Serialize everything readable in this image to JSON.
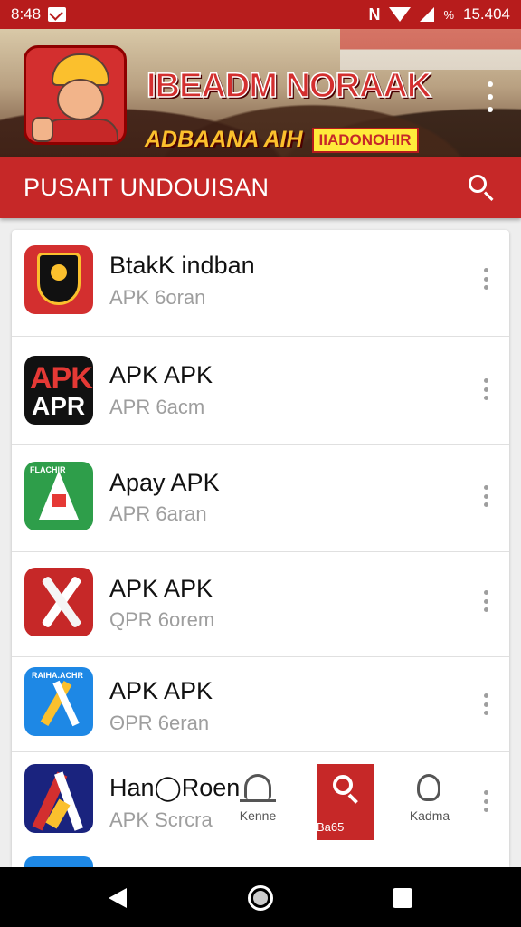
{
  "status_bar": {
    "time": "8:48",
    "signal_glyph": "N",
    "battery_percent_glyph": "%",
    "clock_right": "15.404"
  },
  "banner": {
    "title": "IBEADM NORAAK",
    "subtitle_a": "ADBAANA AIH",
    "subtitle_b": "IIADONOHIR"
  },
  "app_bar": {
    "title": "PUSAIT UNDOUISAN",
    "search_icon": "search-icon"
  },
  "apps": [
    {
      "name": "BtakK indban",
      "sub": "APK 6oran",
      "icon": "shield-app-icon"
    },
    {
      "name": "APK APK",
      "sub": "APR 6acm",
      "icon": "apk-text-app-icon",
      "icon_text_1": "APK",
      "icon_text_2": "APR"
    },
    {
      "name": "Apay APK",
      "sub": "APR 6aran",
      "icon": "green-a-app-icon",
      "icon_text_top": "FLACHIR"
    },
    {
      "name": "APK APK",
      "sub": "QPR 6orem",
      "icon": "red-x-app-icon"
    },
    {
      "name": "APK APK",
      "sub": "ΘPR 6eran",
      "icon": "blue-a-app-icon",
      "icon_text_top": "RAIHA.ACHR"
    },
    {
      "name": "Han◯Roen",
      "sub": "APK Scrcra",
      "icon": "navy-a-app-icon"
    }
  ],
  "mini_nav": {
    "item1_label": "Kenne",
    "item2_label": "Ba65",
    "item3_label": "Kadma"
  },
  "colors": {
    "primary": "#c62828",
    "status_bar": "#b71c1c",
    "subtitle_text": "#9e9e9e"
  }
}
